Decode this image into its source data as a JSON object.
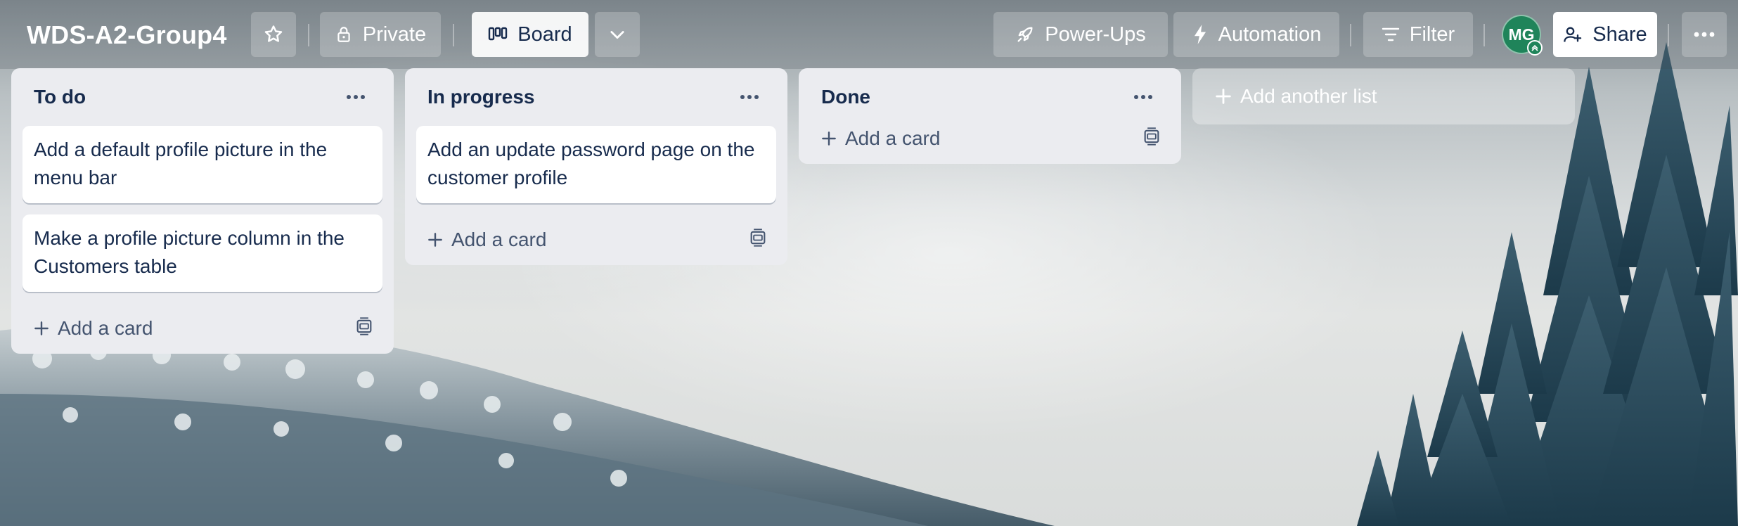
{
  "board": {
    "title": "WDS-A2-Group4",
    "visibility_label": "Private",
    "view_label": "Board"
  },
  "header_actions": {
    "powerups_label": "Power-Ups",
    "automation_label": "Automation",
    "filter_label": "Filter",
    "avatar_initials": "MG",
    "share_label": "Share"
  },
  "lists": [
    {
      "title": "To do",
      "cards": [
        "Add a default profile picture in the menu bar",
        "Make a profile picture column in the Customers table"
      ],
      "add_card_label": "Add a card"
    },
    {
      "title": "In progress",
      "cards": [
        "Add an update password page on the customer profile"
      ],
      "add_card_label": "Add a card"
    },
    {
      "title": "Done",
      "cards": [],
      "add_card_label": "Add a card"
    }
  ],
  "add_list_label": "Add another list",
  "icons": {
    "star": "star-icon",
    "private": "lock-icon",
    "board": "board-view-icon",
    "dropdown": "chevron-down-icon",
    "powerups": "rocket-icon",
    "automation": "lightning-icon",
    "filter": "filter-icon",
    "share": "add-person-icon",
    "more": "ellipsis-icon",
    "template": "card-template-icon",
    "plus": "plus-icon"
  },
  "colors": {
    "avatar": "#1f845a",
    "list_bg": "#ebecf0",
    "text": "#172b4d"
  }
}
